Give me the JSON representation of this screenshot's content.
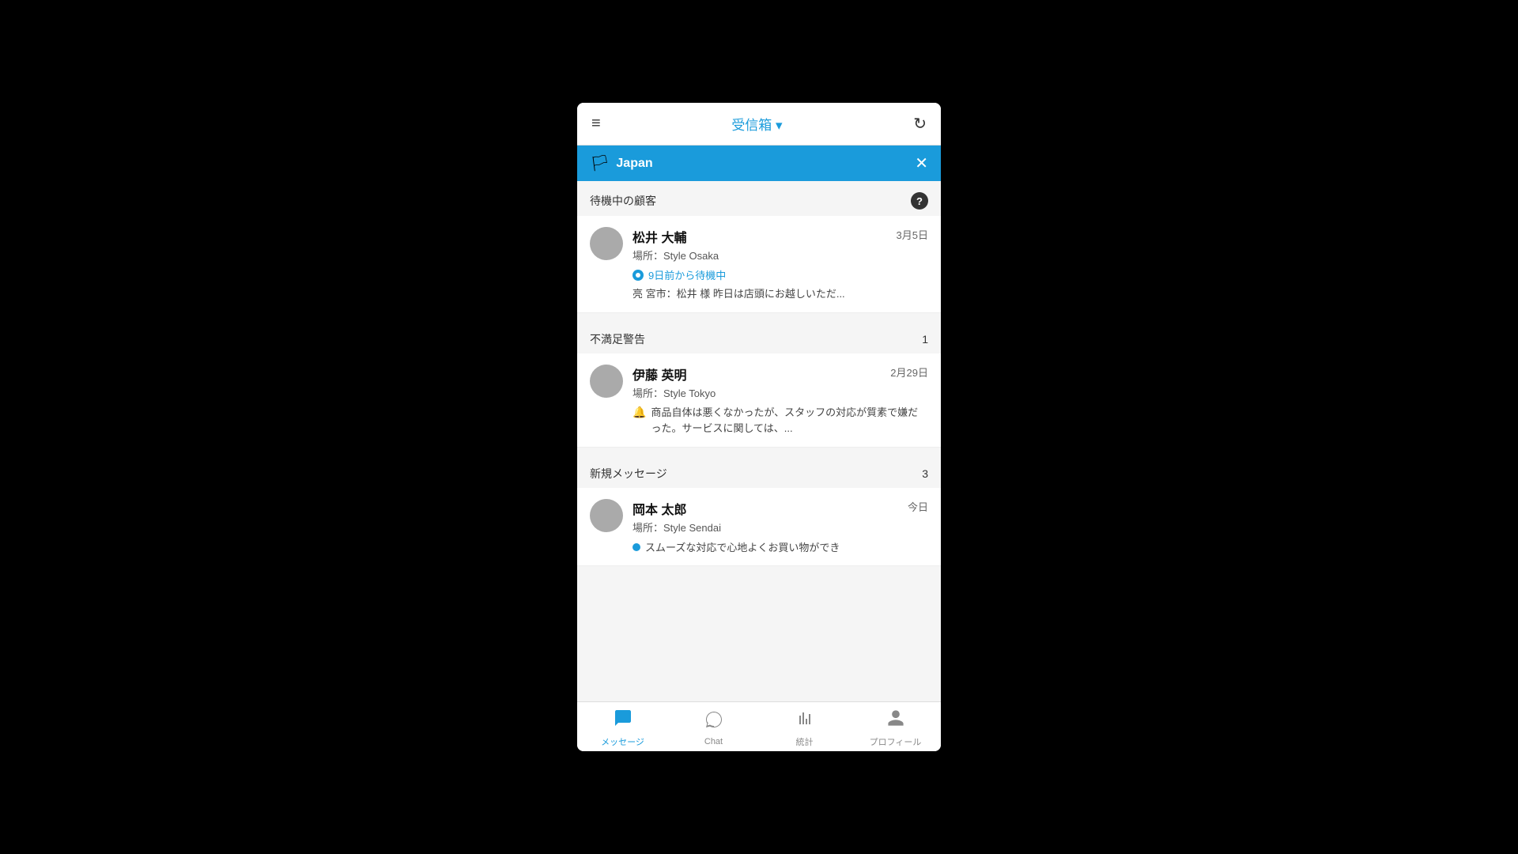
{
  "header": {
    "title": "受信箱 ▾",
    "menu_icon": "≡",
    "refresh_icon": "↻"
  },
  "banner": {
    "flag": "🏳",
    "text": "Japan",
    "close_icon": "✕"
  },
  "sections": [
    {
      "id": "waiting",
      "title": "待機中の顧客",
      "count": "",
      "show_help": true,
      "cards": [
        {
          "name": "松井 大輔",
          "location": "場所：Style Osaka",
          "date": "3月5日",
          "status_type": "waiting",
          "status_text": "9日前から待機中",
          "preview": "亮 宮市：松井 様 昨日は店頭にお越しいただ..."
        }
      ]
    },
    {
      "id": "dissatisfied",
      "title": "不満足警告",
      "count": "1",
      "show_help": false,
      "cards": [
        {
          "name": "伊藤 英明",
          "location": "場所：Style Tokyo",
          "date": "2月29日",
          "status_type": "alert",
          "alert_text": "商品自体は悪くなかったが、スタッフの対応が質素で嫌だった。サービスに関しては、..."
        }
      ]
    },
    {
      "id": "new_messages",
      "title": "新規メッセージ",
      "count": "3",
      "show_help": false,
      "cards": [
        {
          "name": "岡本 太郎",
          "location": "場所：Style Sendai",
          "date": "今日",
          "status_type": "new",
          "preview": "スムーズな対応で心地よくお買い物ができ"
        }
      ]
    }
  ],
  "bottom_nav": [
    {
      "id": "messages",
      "icon": "💬",
      "label": "メッセージ",
      "active": true
    },
    {
      "id": "chat",
      "icon": "💭",
      "label": "Chat",
      "active": false
    },
    {
      "id": "stats",
      "icon": "📊",
      "label": "統計",
      "active": false
    },
    {
      "id": "profile",
      "icon": "👤",
      "label": "プロフィール",
      "active": false
    }
  ]
}
